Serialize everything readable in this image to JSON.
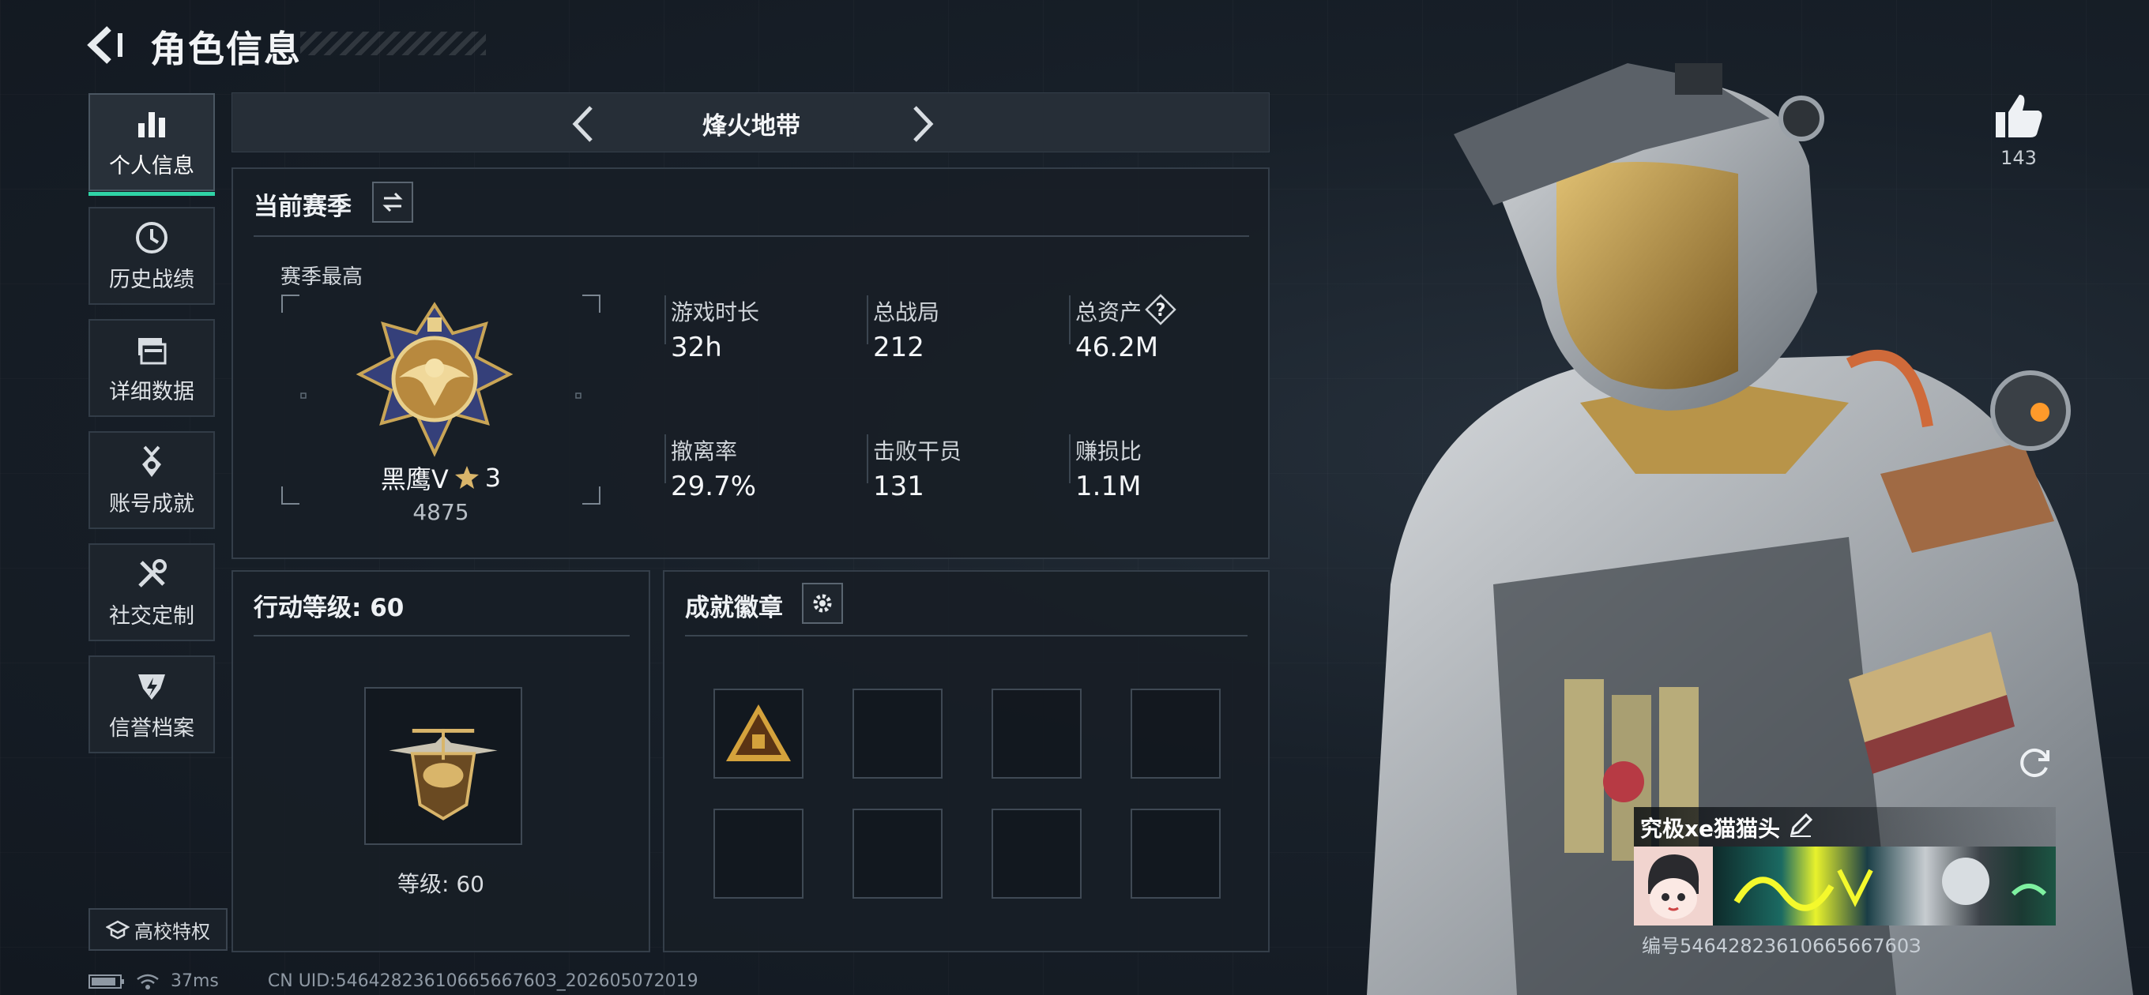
{
  "header": {
    "title": "角色信息"
  },
  "sidebar": {
    "items": [
      {
        "label": "个人信息",
        "icon": "bar-chart-icon",
        "active": true
      },
      {
        "label": "历史战绩",
        "icon": "history-clock-icon",
        "active": false
      },
      {
        "label": "详细数据",
        "icon": "folder-data-icon",
        "active": false
      },
      {
        "label": "账号成就",
        "icon": "achievement-medal-icon",
        "active": false
      },
      {
        "label": "社交定制",
        "icon": "tools-wrench-icon",
        "active": false
      },
      {
        "label": "信誉档案",
        "icon": "shield-bolt-icon",
        "active": false
      }
    ],
    "campus_label": "高校特权"
  },
  "mode": {
    "title": "烽火地带"
  },
  "season": {
    "title": "当前赛季",
    "best_label": "赛季最高",
    "rank_name": "黑鹰V",
    "rank_stars": "3",
    "rank_points": "4875",
    "stats": [
      {
        "label": "游戏时长",
        "value": "32h"
      },
      {
        "label": "总战局",
        "value": "212"
      },
      {
        "label": "总资产",
        "value": "46.2M",
        "has_help": true,
        "help_glyph": "?"
      },
      {
        "label": "撤离率",
        "value": "29.7%"
      },
      {
        "label": "击败干员",
        "value": "131"
      },
      {
        "label": "赚损比",
        "value": "1.1M"
      }
    ]
  },
  "level": {
    "title": "行动等级: 60",
    "caption": "等级: 60"
  },
  "badges": {
    "title": "成就徽章",
    "slots_total": 8,
    "filled": 1
  },
  "profile": {
    "likes": "143",
    "player_name": "究极xe猫猫头",
    "uid_right": "编号5464282361066566760З"
  },
  "status": {
    "ping": "37ms",
    "uid_footer": "CN UID:5464282361066566760З_202605072019"
  },
  "colors": {
    "accent": "#2fd3a6",
    "panel_border": "#343e49",
    "gold": "#c9a556"
  }
}
